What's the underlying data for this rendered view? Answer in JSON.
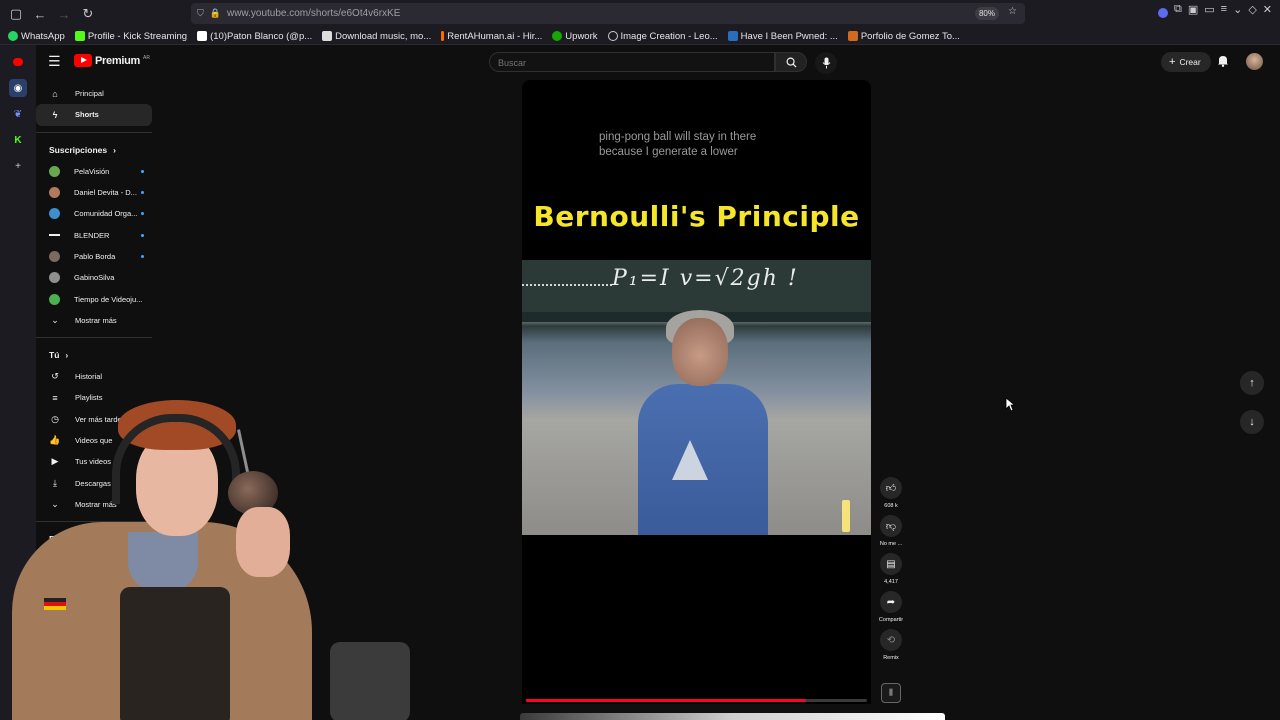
{
  "browser": {
    "url": "www.youtube.com/shorts/e6Ot4v6rxKE",
    "zoom": "80%"
  },
  "bookmarks": [
    {
      "label": "WhatsApp",
      "color": "#25d366"
    },
    {
      "label": "Profile - Kick Streaming",
      "color": "#53fc18"
    },
    {
      "label": "(10)Paton Blanco (@p...",
      "color": "#ffffff"
    },
    {
      "label": "Download music, mo...",
      "color": "#dddddd"
    },
    {
      "label": "RentAHuman.ai - Hir...",
      "color": "#ff6a00"
    },
    {
      "label": "Upwork",
      "color": "#14a800"
    },
    {
      "label": "Image Creation - Leo...",
      "color": "#9b9bff"
    },
    {
      "label": "Have I Been Pwned: ...",
      "color": "#2a6ebb"
    },
    {
      "label": "Porfolio de Gomez To...",
      "color": "#d2691e"
    }
  ],
  "header": {
    "brand": "Premium",
    "brand_sup": "AR",
    "search_placeholder": "Buscar",
    "create_label": "Crear"
  },
  "sidebar": {
    "main": [
      {
        "label": "Principal",
        "icon": "home-icon"
      },
      {
        "label": "Shorts",
        "icon": "shorts-icon"
      }
    ],
    "subs_title": "Suscripciones",
    "subs": [
      {
        "label": "PelaVisión",
        "color": "#6aa84f"
      },
      {
        "label": "Daniel Devita - D...",
        "color": "#b07c5c"
      },
      {
        "label": "Comunidad Orga...",
        "color": "#3e8ed0"
      },
      {
        "label": "BLENDER",
        "color": "#222222"
      },
      {
        "label": "Pablo Borda",
        "color": "#7a6a60"
      },
      {
        "label": "GabinoSilva",
        "color": "#8f8f8f"
      },
      {
        "label": "Tiempo de Videoju...",
        "color": "#4caf50"
      }
    ],
    "subs_more": "Mostrar más",
    "you_title": "Tú",
    "you": [
      {
        "label": "Historial"
      },
      {
        "label": "Playlists"
      },
      {
        "label": "Ver más tarde"
      },
      {
        "label": "Videos que"
      },
      {
        "label": "Tus videos"
      },
      {
        "label": "Descargas"
      }
    ],
    "you_more": "Mostrar más",
    "explore_title": "Expl"
  },
  "short": {
    "caption_line1": "ping-pong ball will stay in there",
    "caption_line2": "because I generate a lower",
    "title": "Bernoulli's  Principle",
    "board_text": "P₁=I   v=√2gh !",
    "progress": 0.82
  },
  "actions": {
    "likes": "608 k",
    "dislike_label": "No me ...",
    "comments": "4,417",
    "share_label": "Compartir",
    "remix_label": "Remix"
  }
}
